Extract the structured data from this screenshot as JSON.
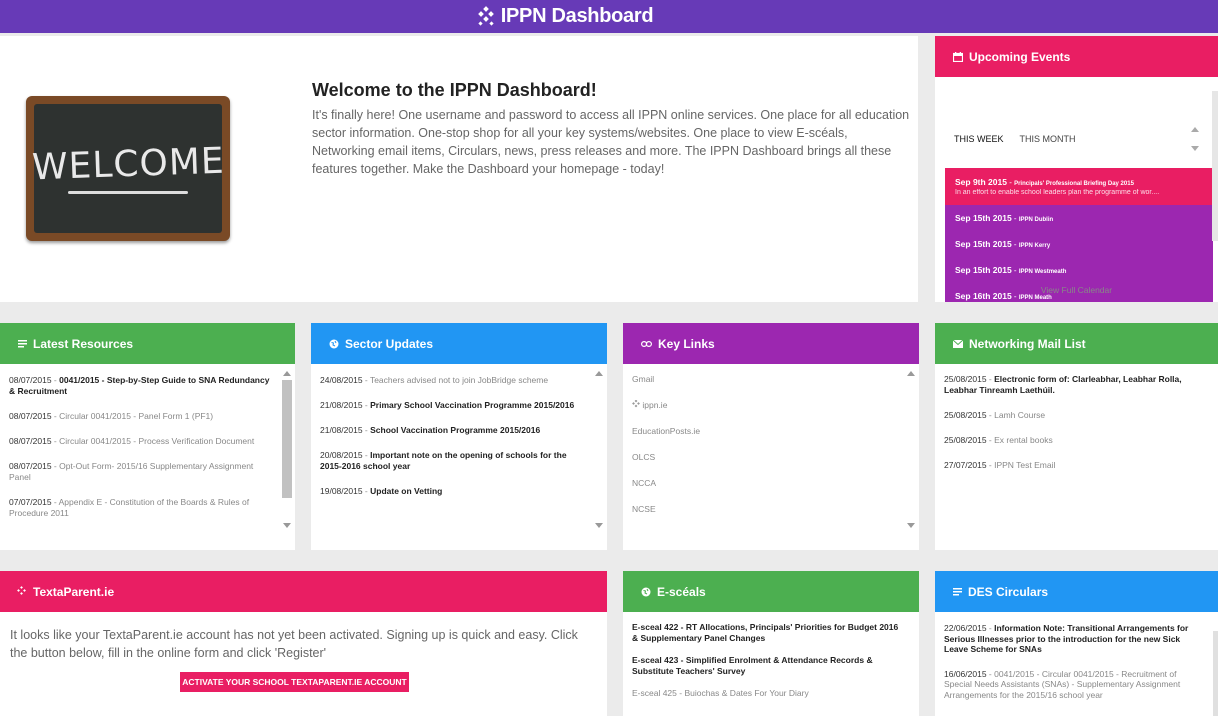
{
  "header": {
    "title": "IPPN Dashboard"
  },
  "hero": {
    "image_text": "WELCOME",
    "title": "Welcome to the IPPN Dashboard!",
    "body": "It's finally here!  One username and password to access all IPPN online services.  One place for all education sector information.  One-stop shop for all your key systems/websites.  One place to view E-scéals, Networking email items, Circulars, news, press releases and more.  The IPPN Dashboard brings all these features together. Make the Dashboard your homepage - today!",
    "slides": 4,
    "active_slide": 4
  },
  "events": {
    "title": "Upcoming Events",
    "tabs": [
      "THIS WEEK",
      "THIS MONTH"
    ],
    "items": [
      {
        "date": "Sep 9th 2015",
        "name": "Principals' Professional Briefing Day 2015",
        "desc": "In an effort to enable school leaders plan the programme of wor...."
      },
      {
        "date": "Sep 15th 2015",
        "name": "IPPN Dublin"
      },
      {
        "date": "Sep 15th 2015",
        "name": "IPPN Kerry"
      },
      {
        "date": "Sep 15th 2015",
        "name": "IPPN Westmeath"
      },
      {
        "date": "Sep 16th 2015",
        "name": "IPPN Meath"
      }
    ],
    "view_all": "View Full Calendar"
  },
  "resources": {
    "title": "Latest Resources",
    "items": [
      {
        "date": "08/07/2015",
        "text": "0041/2015 - Step-by-Step Guide to SNA Redundancy & Recruitment",
        "bold": true
      },
      {
        "date": "08/07/2015",
        "text": "Circular 0041/2015 - Panel Form 1 (PF1)",
        "bold": false
      },
      {
        "date": "08/07/2015",
        "text": "Circular 0041/2015 - Process Verification Document",
        "bold": false
      },
      {
        "date": "08/07/2015",
        "text": "Opt-Out Form- 2015/16 Supplementary Assignment Panel",
        "bold": false
      },
      {
        "date": "07/07/2015",
        "text": "Appendix E - Constitution of the Boards & Rules of Procedure 2011",
        "bold": false
      }
    ]
  },
  "sector": {
    "title": "Sector Updates",
    "items": [
      {
        "date": "24/08/2015",
        "text": "Teachers advised not to join JobBridge scheme",
        "bold": false
      },
      {
        "date": "21/08/2015",
        "text": "Primary School Vaccination Programme 2015/2016",
        "bold": true
      },
      {
        "date": "21/08/2015",
        "text": "School Vaccination Programme 2015/2016",
        "bold": true
      },
      {
        "date": "20/08/2015",
        "text": "Important note on the opening of schools for the 2015-2016 school year",
        "bold": true
      },
      {
        "date": "19/08/2015",
        "text": "Update on Vetting",
        "bold": true
      }
    ]
  },
  "links": {
    "title": "Key Links",
    "items": [
      "Gmail",
      "ippn.ie",
      "EducationPosts.ie",
      "OLCS",
      "NCCA",
      "NCSE"
    ]
  },
  "mail": {
    "title": "Networking Mail List",
    "items": [
      {
        "date": "25/08/2015",
        "text": "Electronic form of: Clarleabhar, Leabhar Rolla, Leabhar Tinreamh Laethúil.",
        "bold": true
      },
      {
        "date": "25/08/2015",
        "text": "Lamh Course",
        "bold": false
      },
      {
        "date": "25/08/2015",
        "text": "Ex rental books",
        "bold": false
      },
      {
        "date": "27/07/2015",
        "text": "IPPN Test Email",
        "bold": false
      }
    ]
  },
  "textaparent": {
    "title": "TextaParent.ie",
    "body": "It looks like your TextaParent.ie account has not yet been activated. Signing up is quick and easy. Click the button below, fill in the online form and click 'Register'",
    "button": "ACTIVATE YOUR SCHOOL TEXTAPARENT.IE ACCOUNT"
  },
  "esceals": {
    "title": "E-scéals",
    "items": [
      {
        "text": "E-sceal 422 - RT Allocations, Principals' Priorities for Budget 2016 & Supplementary Panel Changes",
        "bold": true
      },
      {
        "text": "E-sceal 423 - Simplified Enrolment & Attendance Records & Substitute Teachers' Survey",
        "bold": true
      },
      {
        "text": "E-sceal 425 - Buiochas & Dates For Your Diary",
        "bold": false
      }
    ]
  },
  "circulars": {
    "title": "DES Circulars",
    "items": [
      {
        "date": "22/06/2015",
        "text": "Information Note: Transitional Arrangements for Serious Illnesses prior to the introduction for the new Sick Leave Scheme for SNAs",
        "bold": true
      },
      {
        "date": "16/06/2015",
        "text": "0041/2015 - Circular 0041/2015 - Recruitment of Special Needs Assistants (SNAs) - Supplementary Assignment Arrangements for the 2015/16 school year",
        "bold": false
      }
    ]
  },
  "colors": {
    "purple_header": "#673ab7",
    "pink": "#e91e63",
    "green": "#4caf50",
    "blue": "#2196f3",
    "violet": "#9c27b0"
  }
}
